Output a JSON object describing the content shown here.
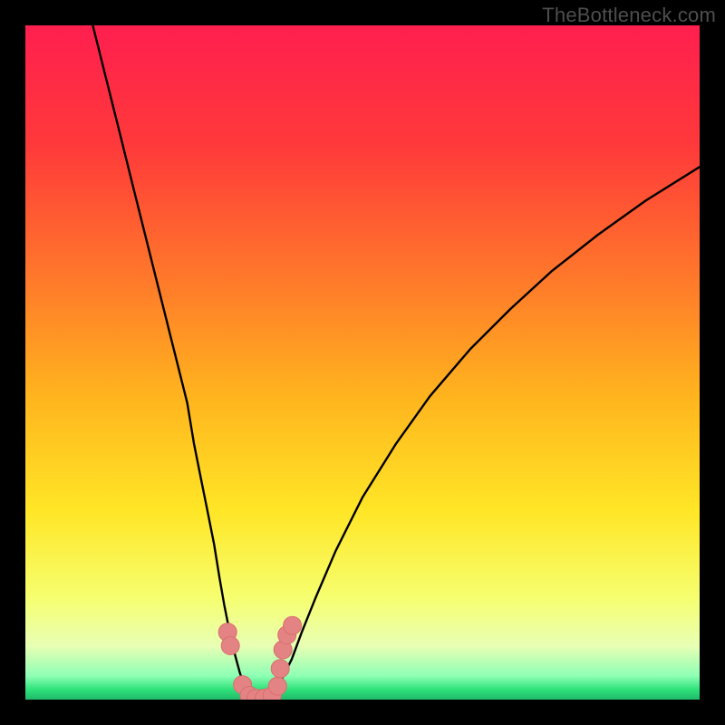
{
  "watermark": "TheBottleneck.com",
  "colors": {
    "frame": "#000000",
    "gradient_stops": [
      {
        "offset": 0.0,
        "color": "#ff1f4f"
      },
      {
        "offset": 0.18,
        "color": "#ff3a3a"
      },
      {
        "offset": 0.38,
        "color": "#ff7a2a"
      },
      {
        "offset": 0.55,
        "color": "#ffb41e"
      },
      {
        "offset": 0.72,
        "color": "#ffe626"
      },
      {
        "offset": 0.85,
        "color": "#f6ff70"
      },
      {
        "offset": 0.92,
        "color": "#e8ffb4"
      },
      {
        "offset": 0.965,
        "color": "#8dffb5"
      },
      {
        "offset": 0.985,
        "color": "#2fe27a"
      },
      {
        "offset": 1.0,
        "color": "#1fb96a"
      }
    ],
    "curve": "#000000",
    "marker_fill": "#e48383",
    "marker_stroke": "#d86f6f"
  },
  "chart_data": {
    "type": "line",
    "title": "",
    "xlabel": "",
    "ylabel": "",
    "xlim": [
      0,
      100
    ],
    "ylim": [
      0,
      100
    ],
    "series": [
      {
        "name": "left-branch",
        "x": [
          10,
          12,
          14,
          16,
          18,
          20,
          22,
          24,
          25,
          26,
          27,
          28,
          28.8,
          29.5,
          30.2,
          31,
          31.8,
          32.5,
          33
        ],
        "y": [
          100,
          92,
          84,
          76,
          68,
          60,
          52,
          44,
          38,
          33,
          28,
          23,
          18,
          14,
          10.5,
          7,
          4,
          2,
          0.5
        ]
      },
      {
        "name": "right-branch",
        "x": [
          37,
          38,
          39.5,
          41,
          43,
          46,
          50,
          55,
          60,
          66,
          72,
          78,
          85,
          92,
          100
        ],
        "y": [
          0.5,
          3,
          6,
          10,
          15,
          22,
          30,
          38,
          45,
          52,
          58,
          63.5,
          69,
          74,
          79
        ]
      },
      {
        "name": "trough",
        "x": [
          33,
          33.8,
          34.7,
          35.5,
          36.3,
          37
        ],
        "y": [
          0.5,
          0.15,
          0.05,
          0.05,
          0.15,
          0.5
        ]
      }
    ],
    "scatter": {
      "name": "highlighted-points",
      "points": [
        {
          "x": 30.0,
          "y": 10.0
        },
        {
          "x": 30.4,
          "y": 8.0
        },
        {
          "x": 32.2,
          "y": 2.2
        },
        {
          "x": 33.2,
          "y": 0.6
        },
        {
          "x": 34.2,
          "y": 0.2
        },
        {
          "x": 35.4,
          "y": 0.2
        },
        {
          "x": 36.6,
          "y": 0.6
        },
        {
          "x": 37.4,
          "y": 2.0
        },
        {
          "x": 37.8,
          "y": 4.6
        },
        {
          "x": 38.2,
          "y": 7.4
        },
        {
          "x": 38.8,
          "y": 9.6
        },
        {
          "x": 39.6,
          "y": 11.0
        }
      ]
    }
  }
}
